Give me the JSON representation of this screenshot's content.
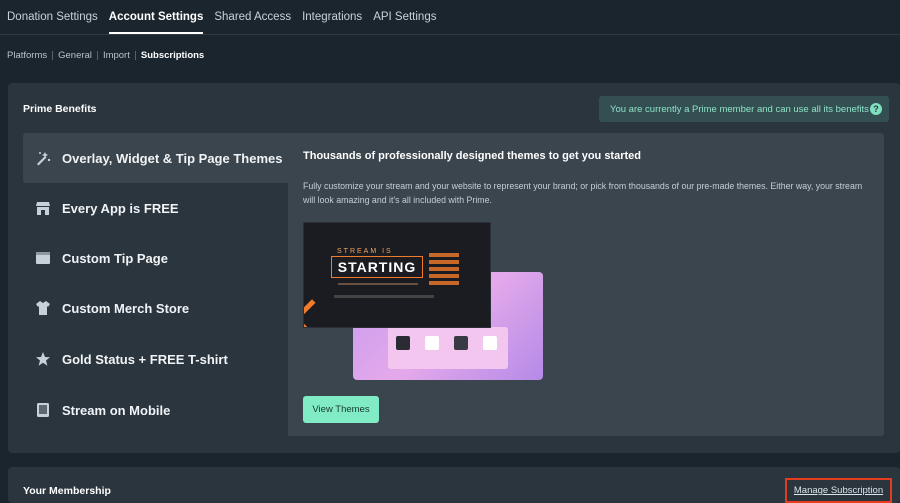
{
  "top_tabs": [
    {
      "label": "Donation Settings",
      "active": false
    },
    {
      "label": "Account Settings",
      "active": true
    },
    {
      "label": "Shared Access",
      "active": false
    },
    {
      "label": "Integrations",
      "active": false
    },
    {
      "label": "API Settings",
      "active": false
    }
  ],
  "sub_tabs": [
    {
      "label": "Platforms",
      "active": false
    },
    {
      "label": "General",
      "active": false
    },
    {
      "label": "Import",
      "active": false
    },
    {
      "label": "Subscriptions",
      "active": true
    }
  ],
  "prime": {
    "title": "Prime Benefits",
    "status_note": "You are currently a Prime member and can use all its benefits",
    "help_icon_glyph": "?",
    "benefits": [
      {
        "label": "Overlay, Widget & Tip Page Themes",
        "icon": "magic-wand-icon",
        "active": true
      },
      {
        "label": "Every App is FREE",
        "icon": "store-icon",
        "active": false
      },
      {
        "label": "Custom Tip Page",
        "icon": "browser-window-icon",
        "active": false
      },
      {
        "label": "Custom Merch Store",
        "icon": "tshirt-icon",
        "active": false
      },
      {
        "label": "Gold Status + FREE T-shirt",
        "icon": "star-icon",
        "active": false
      },
      {
        "label": "Stream on Mobile",
        "icon": "tablet-icon",
        "active": false
      }
    ],
    "detail": {
      "heading": "Thousands of professionally designed themes to get you started",
      "description": "Fully customize your stream and your website to represent your brand; or pick from thousands of our pre-made themes. Either way, your stream will look amazing and it's all included with Prime.",
      "preview_text": "STARTING",
      "preview_caption": "STREAM IS",
      "button_label": "View Themes"
    }
  },
  "membership": {
    "title": "Your Membership",
    "manage_link": "Manage Subscription"
  },
  "colors": {
    "accent": "#80ebc4",
    "background": "#1b252d",
    "card": "#2a353d",
    "highlight_border": "#e53b1f"
  }
}
